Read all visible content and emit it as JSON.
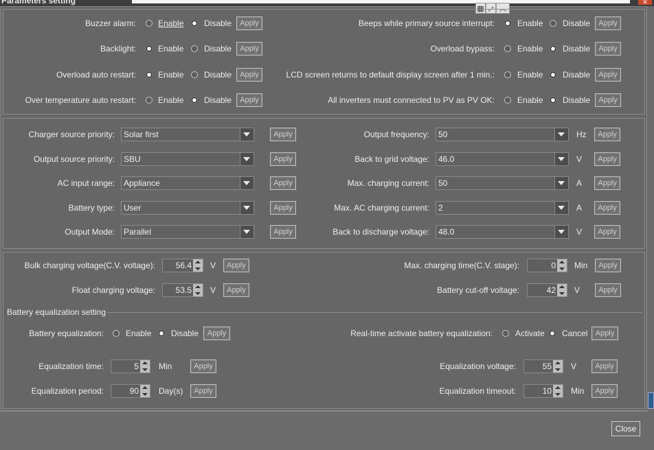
{
  "window": {
    "title": "Parameters setting",
    "close_glyph": "✕"
  },
  "toolbar_icons": [
    "grid-icon",
    "expand-icon",
    "collapse-up-icon"
  ],
  "radio_rows": [
    {
      "label": "Buzzer alarm:",
      "opt1": "Enable",
      "opt2": "Disable",
      "selected": "Disable",
      "apply": "Apply"
    },
    {
      "label": "Backlight:",
      "opt1": "Enable",
      "opt2": "Disable",
      "selected": "Enable",
      "apply": "Apply"
    },
    {
      "label": "Overload auto restart:",
      "opt1": "Enable",
      "opt2": "Disable",
      "selected": "Enable",
      "apply": "Apply"
    },
    {
      "label": "Over temperature auto restart:",
      "opt1": "Enable",
      "opt2": "Disable",
      "selected": "Disable",
      "apply": "Apply"
    },
    {
      "label": "Beeps while primary source interrupt:",
      "opt1": "Enable",
      "opt2": "Disable",
      "selected": "Enable",
      "apply": "Apply"
    },
    {
      "label": "Overload bypass:",
      "opt1": "Enable",
      "opt2": "Disable",
      "selected": "Disable",
      "apply": "Apply"
    },
    {
      "label": "LCD screen returns to default display screen after 1 min.:",
      "opt1": "Enable",
      "opt2": "Disable",
      "selected": "Disable",
      "apply": "Apply"
    },
    {
      "label": "All inverters must connected to PV as PV OK:",
      "opt1": "Enable",
      "opt2": "Disable",
      "selected": "Disable",
      "apply": "Apply"
    }
  ],
  "select_rows": [
    {
      "label": "Charger source priority:",
      "value": "Solar first",
      "unit": "",
      "apply": "Apply"
    },
    {
      "label": "Output source priority:",
      "value": "SBU",
      "unit": "",
      "apply": "Apply"
    },
    {
      "label": "AC input range:",
      "value": "Appliance",
      "unit": "",
      "apply": "Apply"
    },
    {
      "label": "Battery type:",
      "value": "User",
      "unit": "",
      "apply": "Apply"
    },
    {
      "label": "Output Mode:",
      "value": "Parallel",
      "unit": "",
      "apply": "Apply"
    },
    {
      "label": "Output frequency:",
      "value": "50",
      "unit": "Hz",
      "apply": "Apply"
    },
    {
      "label": "Back to grid voltage:",
      "value": "46.0",
      "unit": "V",
      "apply": "Apply"
    },
    {
      "label": "Max. charging current:",
      "value": "50",
      "unit": "A",
      "apply": "Apply"
    },
    {
      "label": "Max. AC charging current:",
      "value": "2",
      "unit": "A",
      "apply": "Apply"
    },
    {
      "label": "Back to discharge voltage:",
      "value": "48.0",
      "unit": "V",
      "apply": "Apply"
    }
  ],
  "spin_rows": [
    {
      "label": "Bulk charging voltage(C.V. voltage):",
      "value": "56.4",
      "unit": "V",
      "apply": "Apply"
    },
    {
      "label": "Float charging voltage:",
      "value": "53.5",
      "unit": "V",
      "apply": "Apply"
    },
    {
      "label": "Max. charging time(C.V. stage):",
      "value": "0",
      "unit": "Min",
      "apply": "Apply"
    },
    {
      "label": "Battery cut-off voltage:",
      "value": "42",
      "unit": "V",
      "apply": "Apply"
    }
  ],
  "equalization": {
    "legend": "Battery equalization setting",
    "eq_label": "Battery equalization:",
    "eq_opt1": "Enable",
    "eq_opt2": "Disable",
    "eq_selected": "Disable",
    "eq_apply": "Apply",
    "rt_label": "Real-time activate battery equalization:",
    "rt_opt1": "Activate",
    "rt_opt2": "Cancel",
    "rt_selected": "Cancel",
    "rt_apply": "Apply",
    "spins": [
      {
        "label": "Equalization time:",
        "value": "5",
        "unit": "Min",
        "apply": "Apply"
      },
      {
        "label": "Equalization period:",
        "value": "90",
        "unit": "Day(s)",
        "apply": "Apply"
      },
      {
        "label": "Equalization voltage:",
        "value": "55",
        "unit": "V",
        "apply": "Apply"
      },
      {
        "label": "Equalization timeout:",
        "value": "10",
        "unit": "Min",
        "apply": "Apply"
      }
    ]
  },
  "footer": {
    "close_label": "Close"
  }
}
